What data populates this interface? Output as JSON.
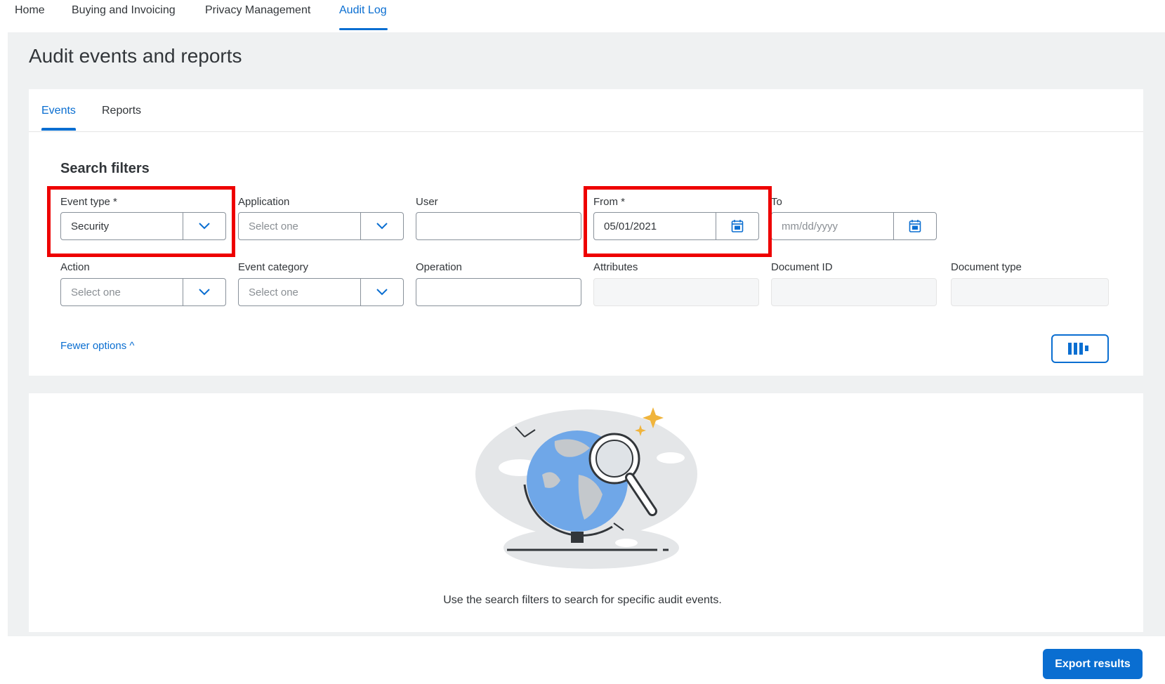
{
  "nav": {
    "items": [
      "Home",
      "Buying and Invoicing",
      "Privacy Management",
      "Audit Log"
    ],
    "active": "Audit Log"
  },
  "page": {
    "title": "Audit events and reports"
  },
  "tabs": [
    "Events",
    "Reports"
  ],
  "filters": {
    "title": "Search filters",
    "event_type": {
      "label": "Event type *",
      "value": "Security"
    },
    "application": {
      "label": "Application",
      "placeholder": "Select one"
    },
    "user": {
      "label": "User",
      "value": ""
    },
    "from": {
      "label": "From *",
      "value": "05/01/2021"
    },
    "to": {
      "label": "To",
      "placeholder": "mm/dd/yyyy"
    },
    "action": {
      "label": "Action",
      "placeholder": "Select one"
    },
    "event_category": {
      "label": "Event category",
      "placeholder": "Select one"
    },
    "operation": {
      "label": "Operation",
      "value": ""
    },
    "attributes": {
      "label": "Attributes"
    },
    "document_id": {
      "label": "Document ID"
    },
    "document_type": {
      "label": "Document type"
    },
    "fewer_options": "Fewer options ^"
  },
  "results": {
    "empty_message": "Use the search filters to search for specific audit events."
  },
  "export_button": "Export results",
  "colors": {
    "accent": "#0a6ed1",
    "highlight": "#ee0000",
    "background": "#eff1f2"
  },
  "icons": [
    "chevron-down-icon",
    "calendar-icon",
    "columns-settings-icon",
    "chevron-up-icon",
    "globe-magnifier-illustration"
  ]
}
